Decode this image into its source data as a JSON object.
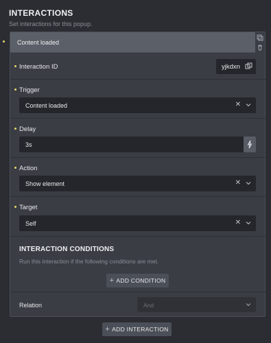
{
  "header": {
    "title": "INTERACTIONS",
    "subtitle": "Set interactions for this popup."
  },
  "interaction": {
    "name": "Content loaded",
    "id_label": "Interaction ID",
    "id_value": "yjkdxn",
    "trigger_label": "Trigger",
    "trigger_value": "Content loaded",
    "delay_label": "Delay",
    "delay_value": "3s",
    "action_label": "Action",
    "action_value": "Show element",
    "target_label": "Target",
    "target_value": "Self"
  },
  "conditions": {
    "title": "INTERACTION CONDITIONS",
    "subtitle": "Run this interaction if the following conditions are met.",
    "add_label": "ADD CONDITION",
    "relation_label": "Relation",
    "relation_placeholder": "And"
  },
  "footer": {
    "add_interaction_label": "ADD INTERACTION"
  },
  "icons": {
    "clone": "clone-icon",
    "delete": "trash-icon",
    "copy": "copy-icon",
    "clear": "clear-x-icon",
    "chevron": "chevron-down-icon",
    "dynamic_data": "bolt-icon",
    "plus": "plus-icon"
  },
  "colors": {
    "background": "#2b2d33",
    "panel": "#3a3d44",
    "panel_header": "#5b5f67",
    "input": "#24262b",
    "accent_dot": "#e8d96a"
  }
}
